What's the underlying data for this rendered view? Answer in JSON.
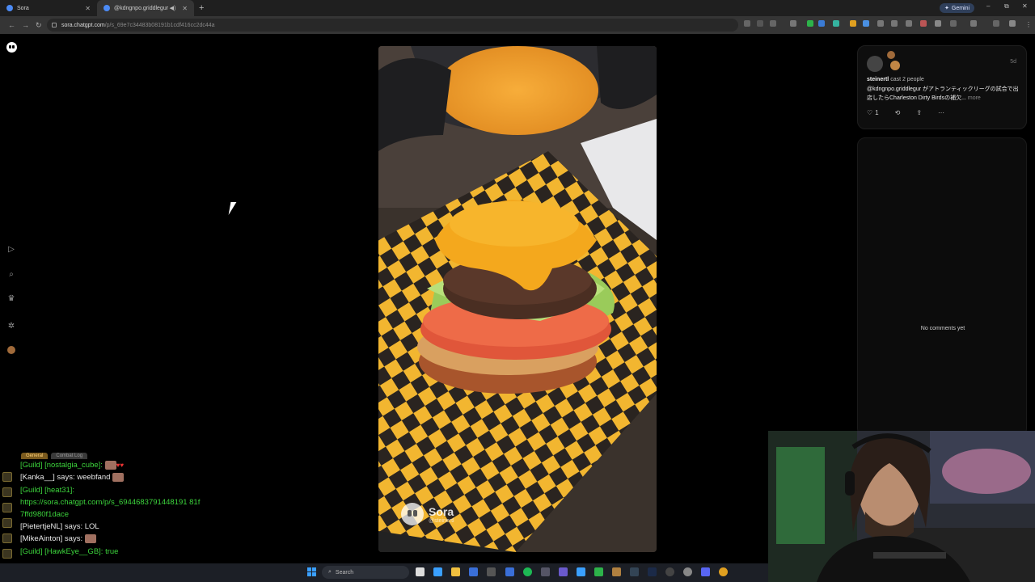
{
  "browser": {
    "tabs": [
      {
        "title": "Sora",
        "active": false
      },
      {
        "title": "@kdngnpo.griddlegur がア",
        "active": true
      }
    ],
    "new_tab_icon": "plus-icon",
    "gemini_label": "Gemini",
    "url_host": "sora.chatgpt.com",
    "url_path": "/p/s_69e7c34483b08191b1cdf416cc2dc44a"
  },
  "post": {
    "author": "steinertl",
    "cast_text": "cast 2 people",
    "time_ago": "5d",
    "caption": "@kdngnpo.griddlegur がアトランティックリーグの試合で出店したらCharleston Dirty Birdsの補欠...",
    "more_label": "more",
    "likes": "1",
    "watermark_brand": "Sora",
    "watermark_user": "@steinertl"
  },
  "comments": {
    "empty_text": "No comments yet"
  },
  "chat": {
    "tabs": [
      "General",
      "Combat Log"
    ],
    "lines": [
      {
        "text": "[Guild] [nostalgia_cube]:",
        "color": "green"
      },
      {
        "text": "[Kanka__] says: weebfand",
        "color": "white"
      },
      {
        "text": "[Guild] [heat31]:",
        "color": "green"
      },
      {
        "text": "https://sora.chatgpt.com/p/s_6944683791448191 81f",
        "color": "green"
      },
      {
        "text": "7ffd980f1dace",
        "color": "green"
      },
      {
        "text": "[PietertjeNL] says: LOL",
        "color": "white"
      },
      {
        "text": "[MikeAinton] says:",
        "color": "white"
      },
      {
        "text": "[Guild] [HawkEye__GB]: true",
        "color": "green"
      }
    ]
  },
  "taskbar": {
    "search_label": "Search"
  },
  "colors": {
    "checker_yellow": "#f2b630",
    "checker_dark": "#2a2420",
    "cheese": "#f4a81d",
    "chat_green": "#3cd43c"
  }
}
